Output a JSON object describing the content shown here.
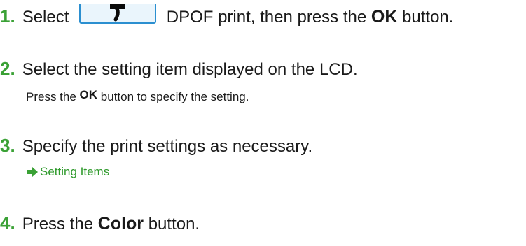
{
  "steps": [
    {
      "num": "1.",
      "text_before": "Select",
      "icon": "dpof-print-icon",
      "text_after": "DPOF print, then press the",
      "bold": "OK",
      "text_end": "button."
    },
    {
      "num": "2.",
      "text": "Select the setting item displayed on the LCD.",
      "sub_before": "Press the",
      "sub_bold": "OK",
      "sub_after": "button to specify the setting."
    },
    {
      "num": "3.",
      "text": "Specify the print settings as necessary.",
      "link": "Setting Items",
      "link_icon": "right-arrow-icon"
    },
    {
      "num": "4.",
      "text_before": "Press the",
      "bold": "Color",
      "text_end": "button."
    }
  ],
  "colors": {
    "step_number": "#3aa135",
    "link": "#2f9a2c",
    "icon_border": "#2b8fd0",
    "icon_fill": "#eaf5fc"
  }
}
